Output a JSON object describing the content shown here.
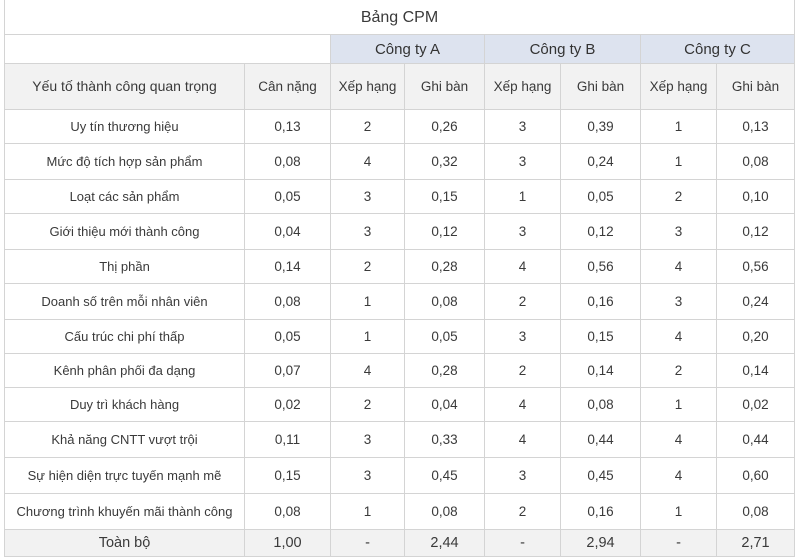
{
  "table_title": "Bảng CPM",
  "companies": [
    "Công ty A",
    "Công ty B",
    "Công ty C"
  ],
  "headers": {
    "factor": "Yếu tố thành công quan trọng",
    "weight": "Cân nặng",
    "rank": "Xếp hạng",
    "score": "Ghi bàn"
  },
  "rows": [
    {
      "factor": "Uy tín thương hiệu",
      "weight": "0,13",
      "a_rank": "2",
      "a_score": "0,26",
      "b_rank": "3",
      "b_score": "0,39",
      "c_rank": "1",
      "c_score": "0,13"
    },
    {
      "factor": "Mức độ tích hợp sản phẩm",
      "weight": "0,08",
      "a_rank": "4",
      "a_score": "0,32",
      "b_rank": "3",
      "b_score": "0,24",
      "c_rank": "1",
      "c_score": "0,08"
    },
    {
      "factor": "Loạt các sản phẩm",
      "weight": "0,05",
      "a_rank": "3",
      "a_score": "0,15",
      "b_rank": "1",
      "b_score": "0,05",
      "c_rank": "2",
      "c_score": "0,10"
    },
    {
      "factor": "Giới thiệu mới thành công",
      "weight": "0,04",
      "a_rank": "3",
      "a_score": "0,12",
      "b_rank": "3",
      "b_score": "0,12",
      "c_rank": "3",
      "c_score": "0,12"
    },
    {
      "factor": "Thị phần",
      "weight": "0,14",
      "a_rank": "2",
      "a_score": "0,28",
      "b_rank": "4",
      "b_score": "0,56",
      "c_rank": "4",
      "c_score": "0,56"
    },
    {
      "factor": "Doanh số trên mỗi nhân viên",
      "weight": "0,08",
      "a_rank": "1",
      "a_score": "0,08",
      "b_rank": "2",
      "b_score": "0,16",
      "c_rank": "3",
      "c_score": "0,24"
    },
    {
      "factor": "Cấu trúc chi phí thấp",
      "weight": "0,05",
      "a_rank": "1",
      "a_score": "0,05",
      "b_rank": "3",
      "b_score": "0,15",
      "c_rank": "4",
      "c_score": "0,20"
    },
    {
      "factor": "Kênh phân phối đa dạng",
      "weight": "0,07",
      "a_rank": "4",
      "a_score": "0,28",
      "b_rank": "2",
      "b_score": "0,14",
      "c_rank": "2",
      "c_score": "0,14"
    },
    {
      "factor": "Duy trì khách hàng",
      "weight": "0,02",
      "a_rank": "2",
      "a_score": "0,04",
      "b_rank": "4",
      "b_score": "0,08",
      "c_rank": "1",
      "c_score": "0,02"
    },
    {
      "factor": "Khả năng CNTT vượt trội",
      "weight": "0,11",
      "a_rank": "3",
      "a_score": "0,33",
      "b_rank": "4",
      "b_score": "0,44",
      "c_rank": "4",
      "c_score": "0,44"
    },
    {
      "factor": "Sự hiện diện trực tuyến mạnh mẽ",
      "weight": "0,15",
      "a_rank": "3",
      "a_score": "0,45",
      "b_rank": "3",
      "b_score": "0,45",
      "c_rank": "4",
      "c_score": "0,60"
    },
    {
      "factor": "Chương trình khuyến mãi thành công",
      "weight": "0,08",
      "a_rank": "1",
      "a_score": "0,08",
      "b_rank": "2",
      "b_score": "0,16",
      "c_rank": "1",
      "c_score": "0,08"
    }
  ],
  "total": {
    "label": "Toàn bộ",
    "weight": "1,00",
    "a_rank": "-",
    "a_score": "2,44",
    "b_rank": "-",
    "b_score": "2,94",
    "c_rank": "-",
    "c_score": "2,71"
  }
}
